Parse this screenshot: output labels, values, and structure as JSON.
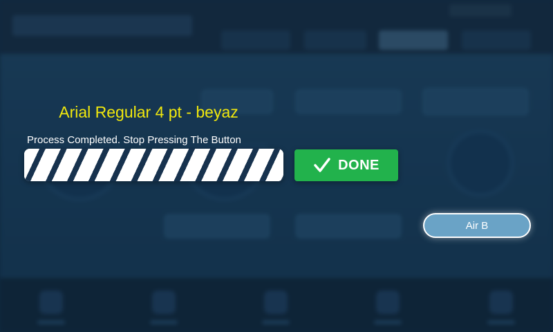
{
  "dialog": {
    "title": "Arial Regular 4 pt - beyaz",
    "status": "Process Completed. Stop Pressing The Button",
    "progress": 1.0,
    "done_label": "DONE",
    "done_icon": "checkmark-icon"
  },
  "buttons": {
    "air_b_label": "Air B"
  },
  "colors": {
    "title": "#f1e80d",
    "done_button": "#22b24c",
    "air_b_button": "#6aa3c6",
    "progress_stripe": "#17324e",
    "background": "#153550"
  }
}
